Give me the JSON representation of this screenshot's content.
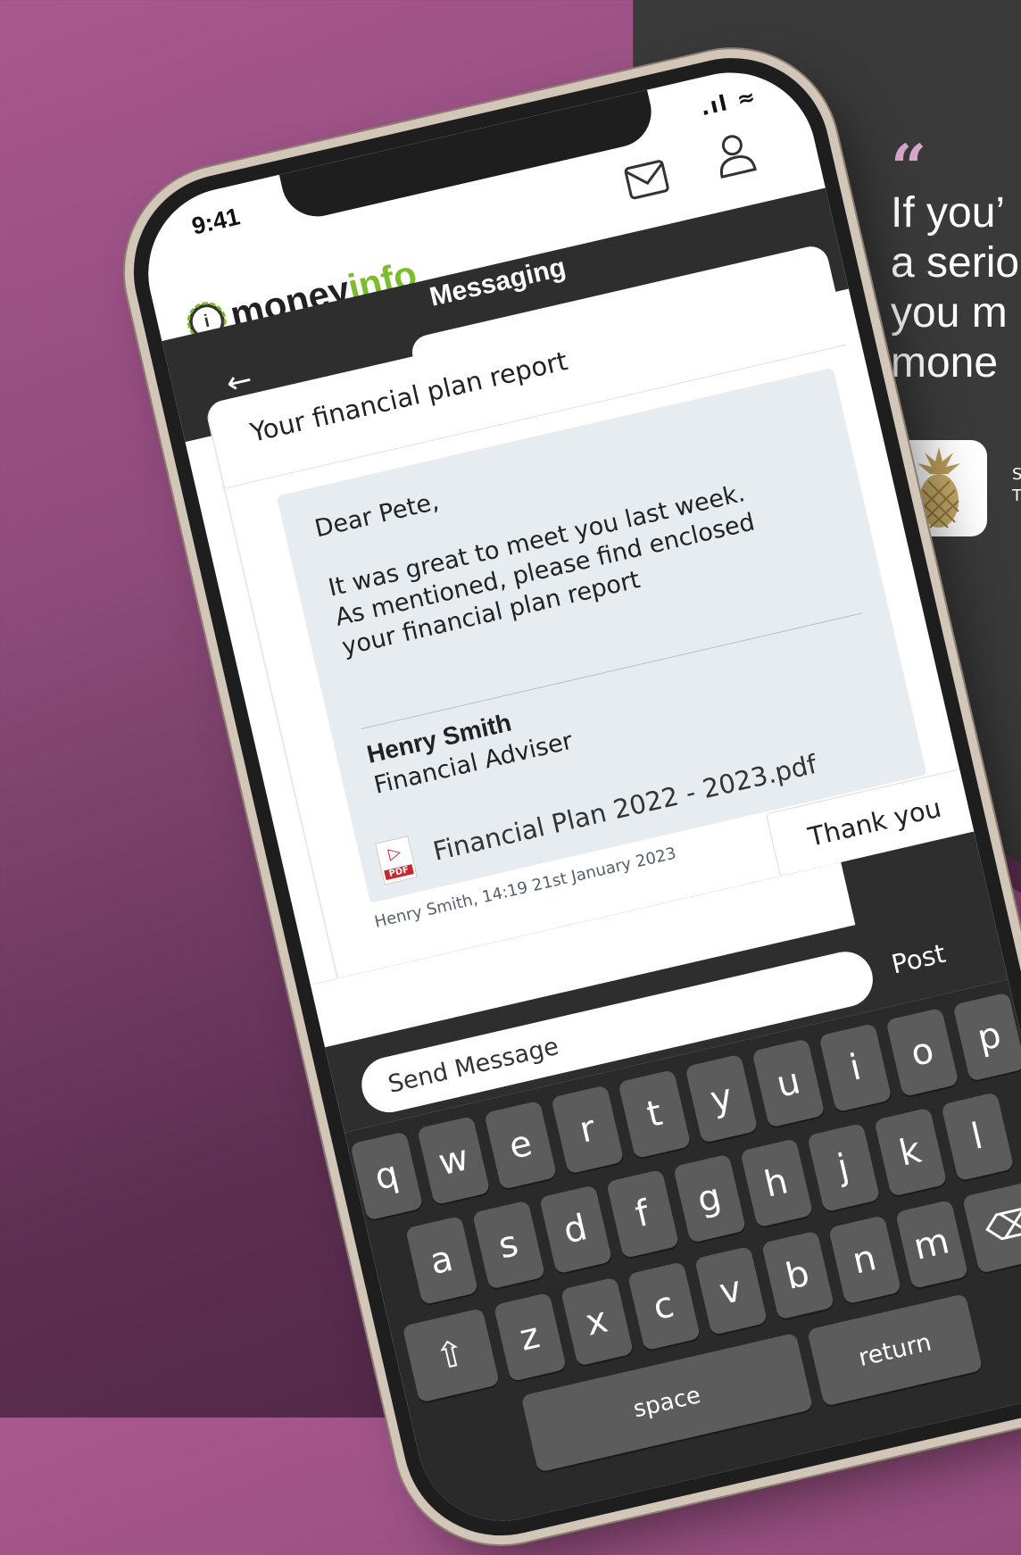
{
  "quote": {
    "mark": "“",
    "lines": [
      "If you’",
      "a serio",
      "you m",
      "mone"
    ],
    "caption": [
      "S",
      "T"
    ]
  },
  "status": {
    "time": "9:41",
    "icons": ".ıl ≈"
  },
  "app": {
    "logo_money": "money",
    "logo_info": "info",
    "logo_icon": "i"
  },
  "nav": {
    "title": "Messaging",
    "back_icon": "←"
  },
  "message": {
    "subject": "Your financial plan report",
    "greeting": "Dear Pete,",
    "body": [
      "It was great to meet you last week.",
      "As mentioned, please find enclosed",
      "your financial plan report"
    ],
    "sender_name": "Henry Smith",
    "sender_role": "Financial Adviser",
    "attachment": "Financial Plan 2022 - 2023.pdf",
    "attachment_tag": "PDF",
    "meta": "Henry Smith, 14:19 21st January 2023",
    "reply": "Thank you"
  },
  "compose": {
    "placeholder": "Send Message",
    "post": "Post"
  },
  "keyboard": {
    "row1": [
      "q",
      "w",
      "e",
      "r",
      "t",
      "y",
      "u",
      "i",
      "o",
      "p"
    ],
    "row2": [
      "a",
      "s",
      "d",
      "f",
      "g",
      "h",
      "j",
      "k",
      "l"
    ],
    "row3": [
      "z",
      "x",
      "c",
      "v",
      "b",
      "n",
      "m"
    ],
    "shift": "⇧",
    "backspace": "⌫",
    "space": "space",
    "return": "return"
  }
}
